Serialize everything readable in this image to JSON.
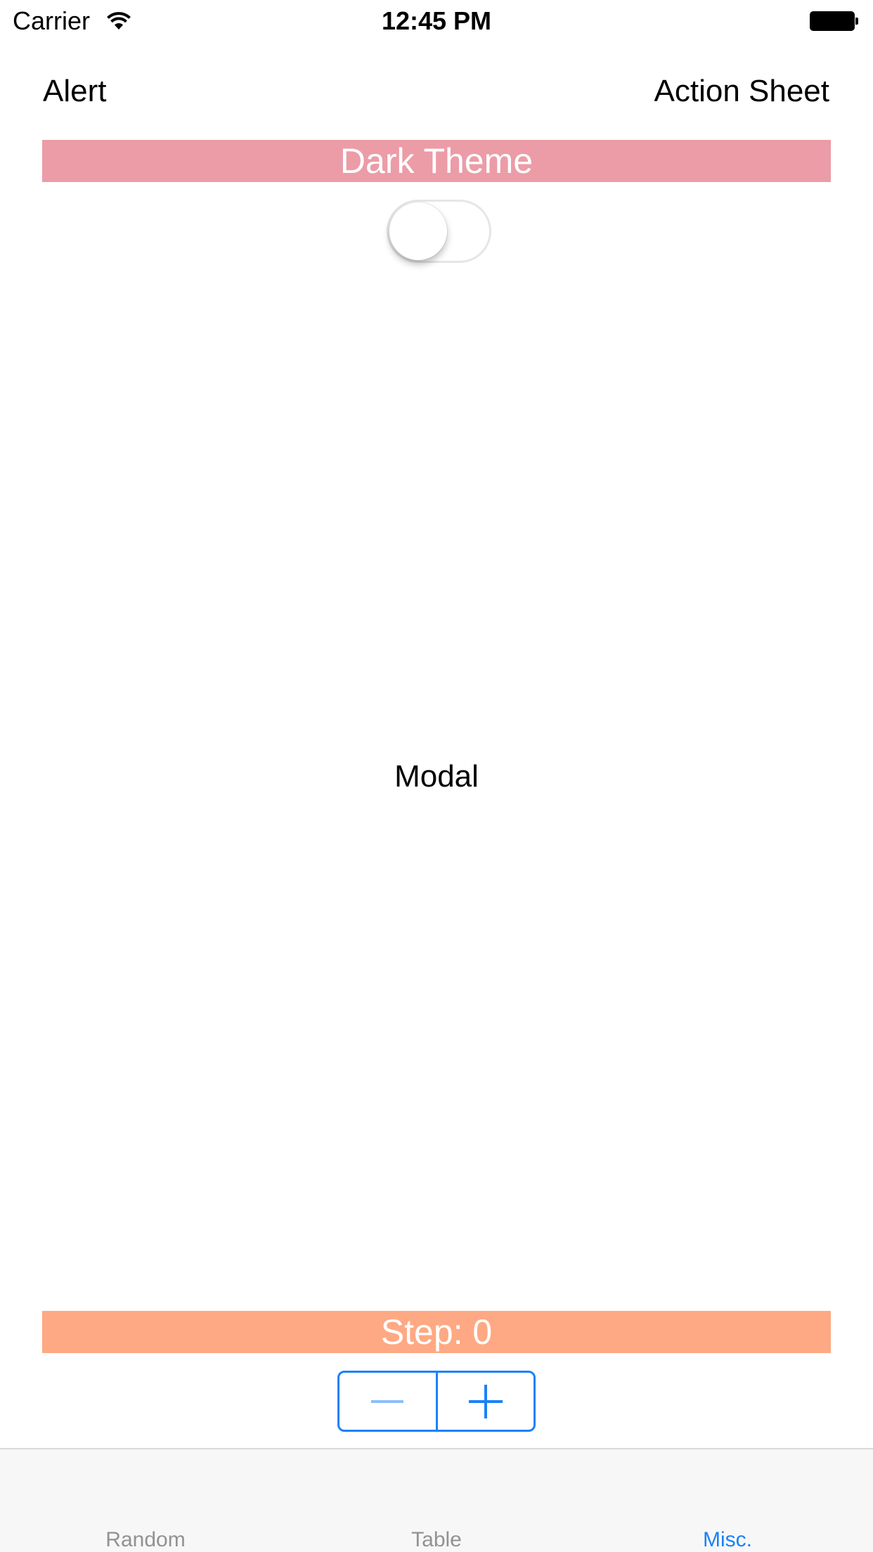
{
  "status_bar": {
    "carrier": "Carrier",
    "time": "12:45 PM",
    "icons": [
      "wifi-icon",
      "battery-icon"
    ]
  },
  "top_actions": {
    "alert_label": "Alert",
    "action_sheet_label": "Action Sheet"
  },
  "theme": {
    "banner_label": "Dark Theme",
    "banner_color": "#eb9ca7",
    "switch_on": false
  },
  "modal_label": "Modal",
  "stepper": {
    "label": "Step: 0",
    "value": 0,
    "banner_color": "#fea983",
    "accent_color": "#1a82f7",
    "decrement_icon": "minus-icon",
    "increment_icon": "plus-icon"
  },
  "tab_bar": {
    "tabs": [
      {
        "label": "Random",
        "active": false
      },
      {
        "label": "Table",
        "active": false
      },
      {
        "label": "Misc.",
        "active": true
      }
    ],
    "active_color": "#1a82f7",
    "inactive_color": "#929292"
  }
}
